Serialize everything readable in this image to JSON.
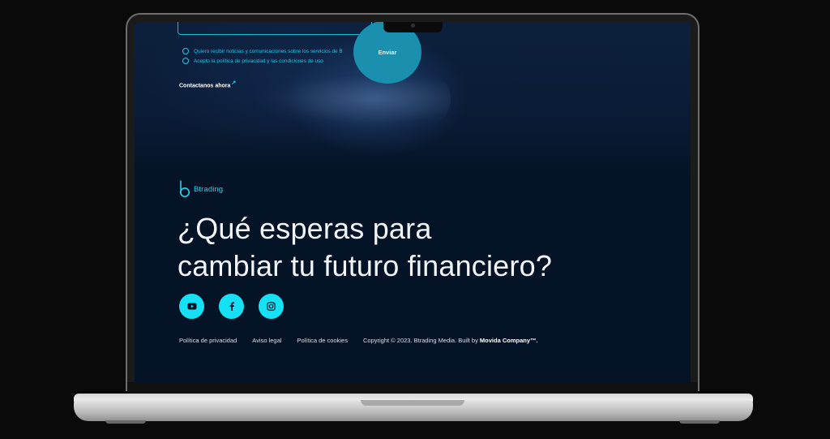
{
  "form": {
    "checkbox_news": "Quiero recibir noticias y comunicaciones sobre los servicios de B",
    "checkbox_privacy": "Acepto la política de privacidad y las condiciones de uso",
    "send_label": "Enviar",
    "contact_label": "Contactanos ahora",
    "contact_arrow": "↗"
  },
  "brand": {
    "name": "Btrading",
    "color": "#22d3ee"
  },
  "headline": {
    "line1": "¿Qué esperas para",
    "line2": "cambiar tu futuro financiero?"
  },
  "socials": [
    {
      "icon": "youtube-icon"
    },
    {
      "icon": "facebook-icon"
    },
    {
      "icon": "instagram-icon"
    }
  ],
  "footer": {
    "privacy": "Política de privacidad",
    "legal": "Aviso legal",
    "cookies": "Política de cookies",
    "copyright_prefix": "Copyright © 2023. Btrading Media. Built by ",
    "copyright_company": "Movida Company™."
  },
  "colors": {
    "accent": "#16e0f6",
    "background": "#051326",
    "send_button": "#1a8fae"
  }
}
